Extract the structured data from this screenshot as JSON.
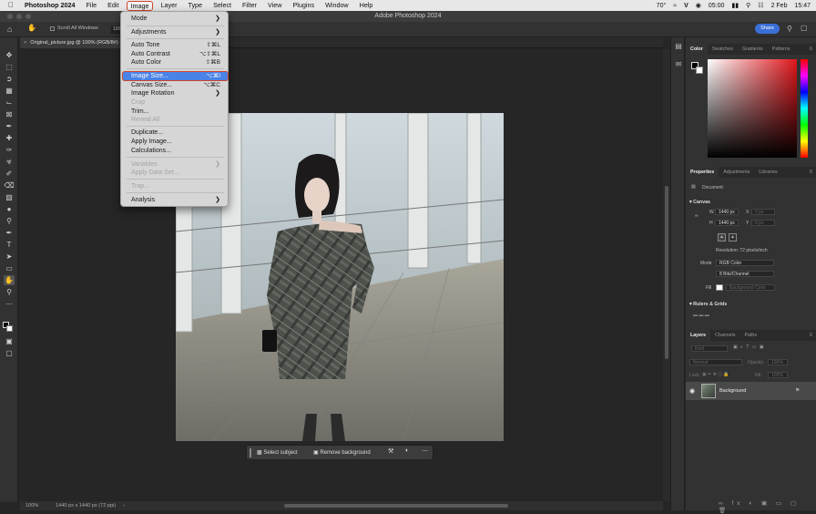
{
  "menubar": {
    "app_name": "Photoshop 2024",
    "items": [
      "File",
      "Edit",
      "Image",
      "Layer",
      "Type",
      "Select",
      "Filter",
      "View",
      "Plugins",
      "Window",
      "Help"
    ],
    "active_item": "Image",
    "status": {
      "temperature": "70°",
      "time": "05:00",
      "date": "2 Feb",
      "clock": "15:47"
    }
  },
  "window": {
    "title": "Adobe Photoshop 2024"
  },
  "options_bar": {
    "scroll_all_label": "Scroll All Windows",
    "zoom_value": "100",
    "share_label": "Share"
  },
  "document_tab": {
    "label": "Original_picture.jpg @ 100% (RGB/8#)"
  },
  "image_menu": {
    "items": [
      {
        "label": "Mode",
        "shortcut": "",
        "submenu": true,
        "enabled": true
      },
      {
        "label": "Adjustments",
        "shortcut": "",
        "submenu": true,
        "enabled": true
      },
      {
        "label": "Auto Tone",
        "shortcut": "⇧⌘L",
        "submenu": false,
        "enabled": true
      },
      {
        "label": "Auto Contrast",
        "shortcut": "⌥⇧⌘L",
        "submenu": false,
        "enabled": true
      },
      {
        "label": "Auto Color",
        "shortcut": "⇧⌘B",
        "submenu": false,
        "enabled": true
      },
      {
        "label": "Image Size...",
        "shortcut": "⌥⌘I",
        "submenu": false,
        "enabled": true,
        "highlighted": true
      },
      {
        "label": "Canvas Size...",
        "shortcut": "⌥⌘C",
        "submenu": false,
        "enabled": true
      },
      {
        "label": "Image Rotation",
        "shortcut": "",
        "submenu": true,
        "enabled": true
      },
      {
        "label": "Crop",
        "shortcut": "",
        "submenu": false,
        "enabled": false
      },
      {
        "label": "Trim...",
        "shortcut": "",
        "submenu": false,
        "enabled": true
      },
      {
        "label": "Reveal All",
        "shortcut": "",
        "submenu": false,
        "enabled": false
      },
      {
        "label": "Duplicate...",
        "shortcut": "",
        "submenu": false,
        "enabled": true
      },
      {
        "label": "Apply Image...",
        "shortcut": "",
        "submenu": false,
        "enabled": true
      },
      {
        "label": "Calculations...",
        "shortcut": "",
        "submenu": false,
        "enabled": true
      },
      {
        "label": "Variables",
        "shortcut": "",
        "submenu": true,
        "enabled": false
      },
      {
        "label": "Apply Data Set...",
        "shortcut": "",
        "submenu": false,
        "enabled": false
      },
      {
        "label": "Trap...",
        "shortcut": "",
        "submenu": false,
        "enabled": false
      },
      {
        "label": "Analysis",
        "shortcut": "",
        "submenu": true,
        "enabled": true
      }
    ]
  },
  "taskbar": {
    "select_subject": "Select subject",
    "remove_background": "Remove background"
  },
  "statusbar": {
    "zoom": "100%",
    "dimensions": "1440 px x 1440 px (72 ppi)"
  },
  "panels": {
    "color_tabs": [
      "Color",
      "Swatches",
      "Gradients",
      "Patterns"
    ],
    "properties_tabs": [
      "Properties",
      "Adjustments",
      "Libraries"
    ],
    "document_label": "Document",
    "canvas_section": "Canvas",
    "width_label": "W",
    "width_value": "1440 px",
    "height_label": "H",
    "height_value": "1440 px",
    "x_label": "X",
    "x_placeholder": "0 px",
    "y_label": "Y",
    "y_placeholder": "0 px",
    "resolution": "Resolution: 72 pixels/inch",
    "mode_label": "Mode",
    "mode_value": "RGB Color",
    "bits_value": "8 Bits/Channel",
    "fill_label": "Fill",
    "fill_value": "Background Color",
    "rulers_section": "Rulers & Grids",
    "layers_tabs": [
      "Layers",
      "Channels",
      "Paths"
    ],
    "kind_placeholder": "Kind",
    "blend_mode": "Normal",
    "opacity_label": "Opacity:",
    "opacity_value": "100%",
    "lock_label": "Lock:",
    "fill2_label": "Fill:",
    "fill2_value": "100%",
    "layer_name": "Background"
  },
  "colors": {
    "accent": "#3b6fd8",
    "menu_highlight": "#4a82e6",
    "annotation": "#d2432a",
    "fg_color": "#000000",
    "bg_color": "#ffffff"
  }
}
